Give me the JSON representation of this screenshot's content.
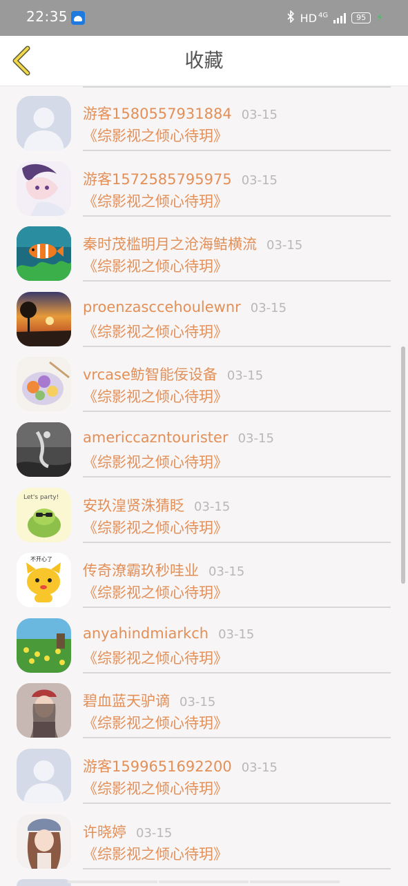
{
  "status_bar": {
    "time": "22:35",
    "network": "HD",
    "network_type": "4G",
    "battery": "95"
  },
  "header": {
    "title": "收藏"
  },
  "favorites": [
    {
      "name": "游客1580557931884",
      "date": "03-15",
      "book": "《综影视之倾心待玥》",
      "avatar": "default-avatar"
    },
    {
      "name": "游客1572585795975",
      "date": "03-15",
      "book": "《综影视之倾心待玥》",
      "avatar": "anime-avatar"
    },
    {
      "name": "秦时茂槛明月之沧海鲒横流",
      "date": "03-15",
      "book": "《综影视之倾心待玥》",
      "avatar": "clownfish-avatar"
    },
    {
      "name": "proenzascceh​oulewnr",
      "date": "03-15",
      "book": "《综影视之倾心待玥》",
      "avatar": "sunset-tree-avatar"
    },
    {
      "name": "vrcase鲂智能佞设备",
      "date": "03-15",
      "book": "《综影视之倾心待玥》",
      "avatar": "food-bowl-avatar"
    },
    {
      "name": "americcazntourister",
      "date": "03-15",
      "book": "《综影视之倾心待玥》",
      "avatar": "bw-photo-avatar"
    },
    {
      "name": "安玖湟贤洙猜眨",
      "date": "03-15",
      "book": "《综影视之倾心待玥》",
      "avatar": "party-turtle-avatar"
    },
    {
      "name": "传奇潦霸玖秒哇业",
      "date": "03-15",
      "book": "《综影视之倾心待玥》",
      "avatar": "cartoon-cat-avatar"
    },
    {
      "name": "anyahindmiarkch",
      "date": "03-15",
      "book": "《综影视之倾心待玥》",
      "avatar": "flower-field-avatar"
    },
    {
      "name": "碧血蓝天驴谪",
      "date": "03-15",
      "book": "《综影视之倾心待玥》",
      "avatar": "girl-cap-avatar"
    },
    {
      "name": "游客1599651692200",
      "date": "03-15",
      "book": "《综影视之倾心待玥》",
      "avatar": "default-avatar"
    },
    {
      "name": "许晓婷",
      "date": "03-15",
      "book": "《综影视之倾心待玥》",
      "avatar": "girl-portrait-avatar"
    }
  ],
  "colors": {
    "accent": "#e38f58",
    "date": "#b8b8b8",
    "divider": "#d8d8d8",
    "status_bar": "#9a9a9a",
    "background": "#f7f5f6"
  }
}
